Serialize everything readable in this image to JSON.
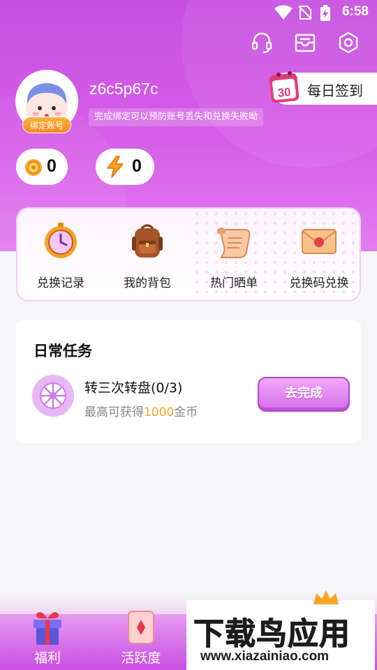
{
  "status_bar": {
    "time": "6:58"
  },
  "profile": {
    "username": "z6c5p67c",
    "bind_badge": "绑定账号",
    "hint": "完成绑定可以预防账号丢失和兑换失败呦"
  },
  "checkin": {
    "day": "30",
    "label": "每日签到"
  },
  "balances": [
    {
      "icon": "coin-icon",
      "value": "0"
    },
    {
      "icon": "lightning-icon",
      "value": "0"
    }
  ],
  "shortcuts": [
    {
      "label": "兑换记录",
      "icon": "clock-icon"
    },
    {
      "label": "我的背包",
      "icon": "backpack-icon"
    },
    {
      "label": "热门晒单",
      "icon": "scroll-icon"
    },
    {
      "label": "兑换码兑换",
      "icon": "envelope-icon"
    }
  ],
  "daily_tasks": {
    "title": "日常任务",
    "items": [
      {
        "name": "转三次转盘(0/3)",
        "desc_prefix": "最高可获得",
        "desc_highlight": "1000",
        "desc_suffix": "金币",
        "button": "去完成"
      }
    ]
  },
  "bottom_nav": [
    {
      "label": "福利",
      "icon": "gift-icon"
    },
    {
      "label": "活跃度",
      "icon": "card-icon"
    }
  ],
  "watermark": {
    "title": "下载鸟应用",
    "url": "www.xiazainiao.com"
  },
  "colors": {
    "accent": "#d65ee8",
    "highlight": "#f3a923",
    "badge": "#f7871f"
  }
}
